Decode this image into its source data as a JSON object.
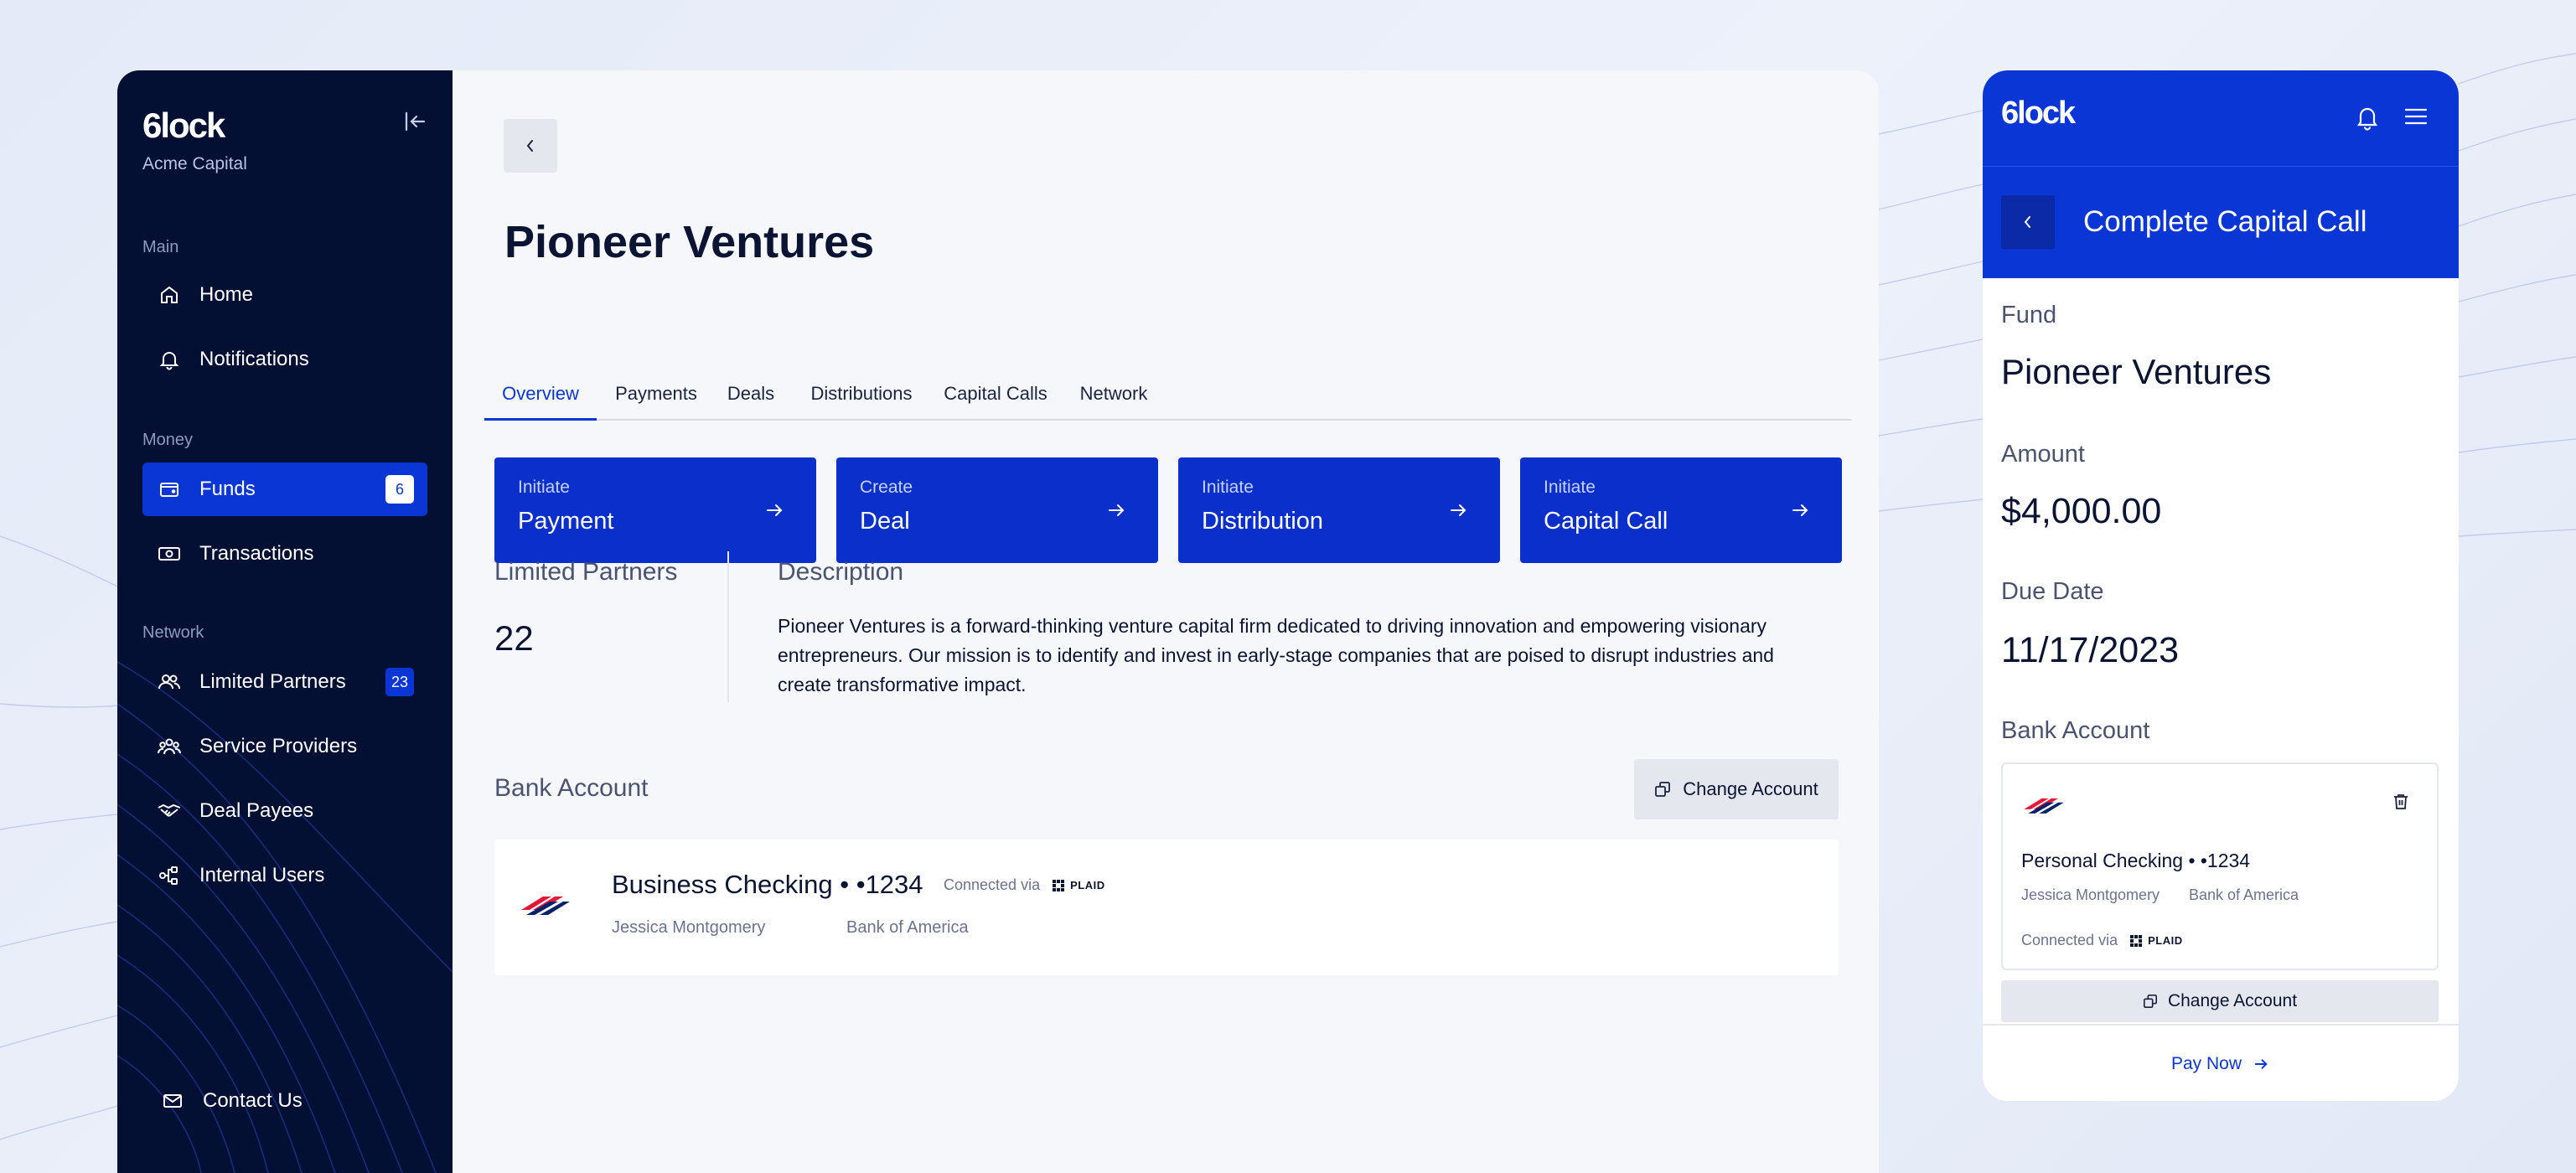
{
  "brand": {
    "logo": "6lock",
    "accent": "#0b36d6",
    "navy": "#030f33"
  },
  "sidebar": {
    "company": "Acme Capital",
    "sections": [
      {
        "label": "Main"
      },
      {
        "label": "Money"
      },
      {
        "label": "Network"
      }
    ],
    "items": [
      {
        "label": "Home",
        "icon": "home-icon"
      },
      {
        "label": "Notifications",
        "icon": "bell-icon"
      },
      {
        "label": "Funds",
        "icon": "wallet-icon",
        "badge": "6",
        "active": true
      },
      {
        "label": "Transactions",
        "icon": "cash-icon"
      },
      {
        "label": "Limited Partners",
        "icon": "users-icon",
        "badge": "23"
      },
      {
        "label": "Service Providers",
        "icon": "group-icon"
      },
      {
        "label": "Deal Payees",
        "icon": "handshake-icon"
      },
      {
        "label": "Internal Users",
        "icon": "network-icon"
      },
      {
        "label": "Contact Us",
        "icon": "mail-icon"
      }
    ]
  },
  "main": {
    "title": "Pioneer Ventures",
    "tabs": [
      {
        "label": "Overview",
        "active": true
      },
      {
        "label": "Payments"
      },
      {
        "label": "Deals"
      },
      {
        "label": "Distributions"
      },
      {
        "label": "Capital Calls"
      },
      {
        "label": "Network"
      }
    ],
    "actions": [
      {
        "verb": "Initiate",
        "noun": "Payment"
      },
      {
        "verb": "Create",
        "noun": "Deal"
      },
      {
        "verb": "Initiate",
        "noun": "Distribution"
      },
      {
        "verb": "Initiate",
        "noun": "Capital Call"
      }
    ],
    "limited_partners": {
      "label": "Limited Partners",
      "value": "22"
    },
    "description": {
      "label": "Description",
      "text": "Pioneer Ventures is a forward-thinking venture capital firm dedicated to driving innovation and empowering visionary entrepreneurs. Our mission is to identify and invest in early-stage companies that are poised to disrupt industries and create transformative impact."
    },
    "bank": {
      "label": "Bank Account",
      "change_label": "Change Account",
      "account": "Business Checking • •1234",
      "connected_via": "Connected via",
      "provider": "PLAID",
      "holder": "Jessica Montgomery",
      "bank_name": "Bank of America"
    }
  },
  "mobile": {
    "title": "Complete Capital Call",
    "fund_label": "Fund",
    "fund_value": "Pioneer Ventures",
    "amount_label": "Amount",
    "amount_value": "$4,000.00",
    "due_label": "Due Date",
    "due_value": "11/17/2023",
    "bank_label": "Bank Account",
    "account": "Personal Checking • •1234",
    "holder": "Jessica Montgomery",
    "bank_name": "Bank of America",
    "connected_via": "Connected via",
    "provider": "PLAID",
    "change_label": "Change Account",
    "pay_label": "Pay Now"
  }
}
